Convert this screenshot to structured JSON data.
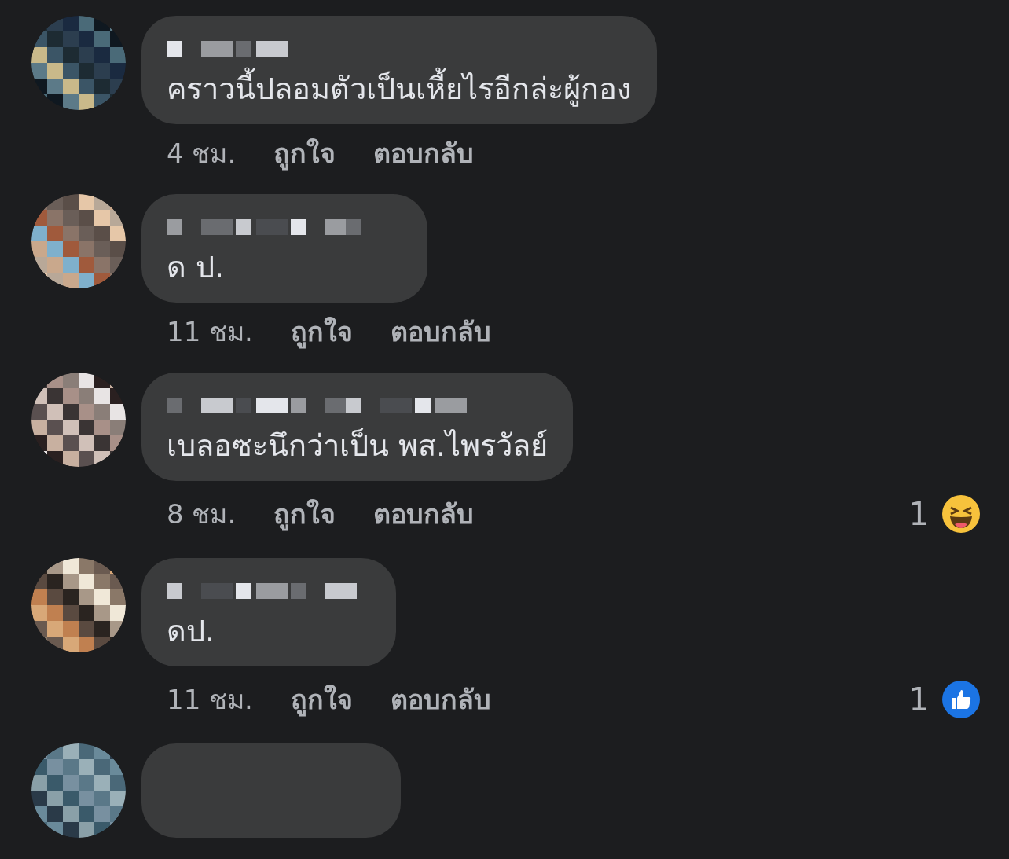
{
  "comments": [
    {
      "kind": "comment",
      "text": "คราวนี้ปลอมตัวเป็นเหี้ยไรอีกล่ะผู้กอง",
      "time": "4 ชม.",
      "like_label": "ถูกใจ",
      "reply_label": "ตอบกลับ"
    },
    {
      "kind": "comment",
      "text": "ด ป.",
      "time": "11 ชม.",
      "like_label": "ถูกใจ",
      "reply_label": "ตอบกลับ"
    },
    {
      "kind": "comment",
      "text": "เบลอซะนึกว่าเป็น พส.ไพรวัลย์",
      "time": "8 ชม.",
      "like_label": "ถูกใจ",
      "reply_label": "ตอบกลับ",
      "reaction": {
        "kind": "haha",
        "count": "1"
      }
    },
    {
      "kind": "comment",
      "text": "ดป.",
      "time": "11 ชม.",
      "like_label": "ถูกใจ",
      "reply_label": "ตอบกลับ",
      "reaction": {
        "kind": "like",
        "count": "1"
      }
    },
    {
      "kind": "cut_off"
    }
  ]
}
